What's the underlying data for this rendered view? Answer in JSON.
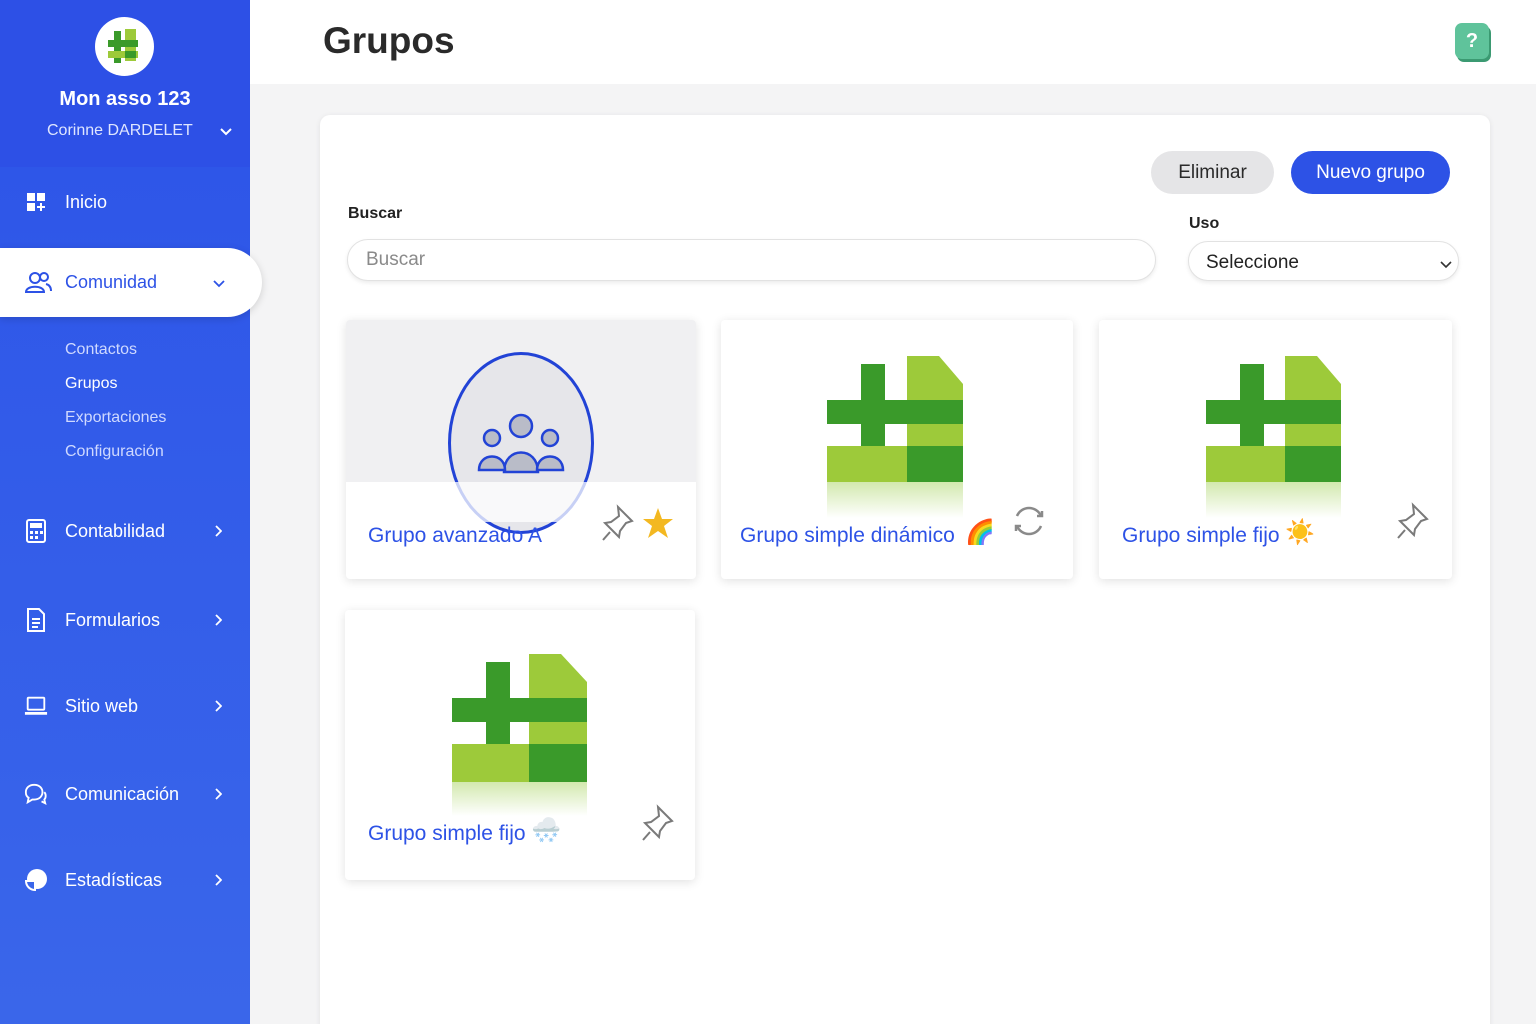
{
  "brand": {
    "name": "Mon asso 123",
    "user": "Corinne DARDELET"
  },
  "nav": {
    "inicio": "Inicio",
    "comunidad": "Comunidad",
    "sub": [
      "Contactos",
      "Grupos",
      "Exportaciones",
      "Configuración"
    ],
    "contabilidad": "Contabilidad",
    "formularios": "Formularios",
    "sitio_web": "Sitio web",
    "comunicacion": "Comunicación",
    "estadisticas": "Estadísticas"
  },
  "header": {
    "title": "Grupos",
    "help": "?"
  },
  "toolbar": {
    "delete_label": "Eliminar",
    "new_label": "Nuevo grupo"
  },
  "filters": {
    "search_label": "Buscar",
    "search_placeholder": "Buscar",
    "use_label": "Uso",
    "use_value": "Seleccione"
  },
  "groups": [
    {
      "name": "Grupo avanzado A",
      "emoji": "",
      "icons": [
        "pin-icon",
        "star-icon"
      ]
    },
    {
      "name": "Grupo simple dinámico",
      "emoji": "🌈",
      "icons": [
        "refresh-icon"
      ]
    },
    {
      "name": "Grupo simple fijo",
      "emoji": "☀️",
      "icons": [
        "pin-icon"
      ]
    },
    {
      "name": "Grupo simple fijo",
      "emoji": "🌨️",
      "icons": [
        "pin-icon"
      ]
    }
  ],
  "colors": {
    "accent": "#2d52e6",
    "sidebar": "#3a66ea",
    "help": "#5fc39b",
    "logo_dark": "#3a9a2a",
    "logo_light": "#9dca3a"
  }
}
